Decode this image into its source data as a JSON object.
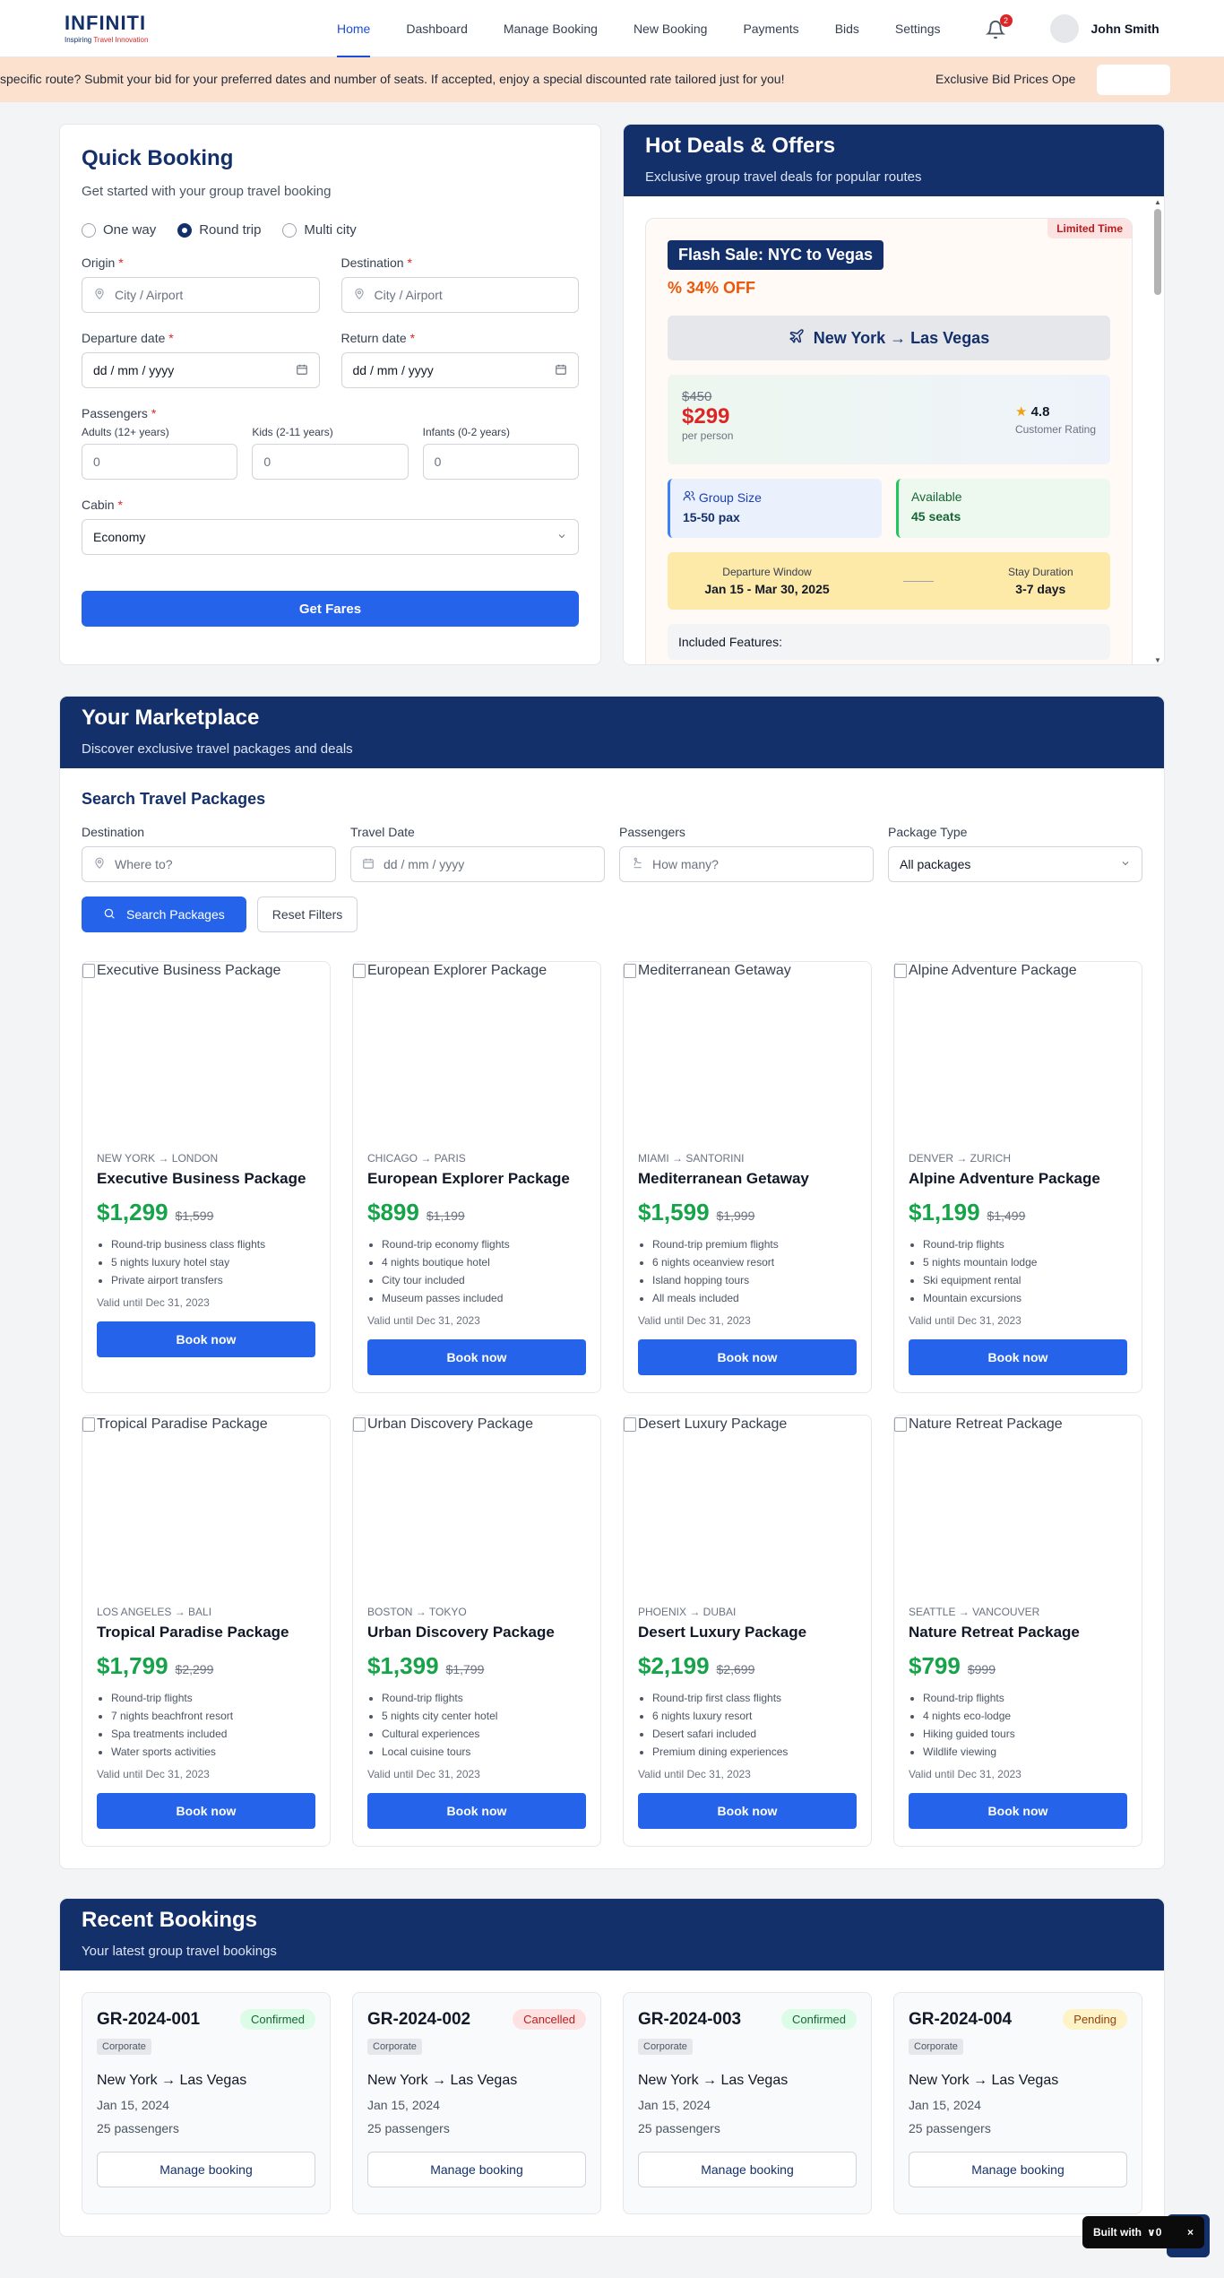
{
  "brand": {
    "name": "INFINITI",
    "tagline_a": "Inspiring ",
    "tagline_b": "Travel Innovation"
  },
  "nav": [
    "Home",
    "Dashboard",
    "Manage Booking",
    "New Booking",
    "Payments",
    "Bids",
    "Settings"
  ],
  "notifications": "2",
  "user": {
    "name": "John Smith"
  },
  "ticker": {
    "text": "specific route? Submit your bid for your preferred dates and number of seats. If accepted, enjoy a special discounted rate tailored just for you!",
    "text2": "Exclusive Bid Prices Ope"
  },
  "quick_booking": {
    "title": "Quick Booking",
    "subtitle": "Get started with your group travel booking",
    "trip_types": [
      "One way",
      "Round trip",
      "Multi city"
    ],
    "origin_label": "Origin",
    "origin_placeholder": "City / Airport",
    "destination_label": "Destination",
    "destination_placeholder": "City / Airport",
    "departure_label": "Departure date",
    "departure_placeholder": "dd / mm / yyyy",
    "return_label": "Return date",
    "return_placeholder": "dd / mm / yyyy",
    "passengers_label": "Passengers",
    "adults_label": "Adults (12+ years)",
    "kids_label": "Kids (2-11 years)",
    "infants_label": "Infants (0-2 years)",
    "adults": "0",
    "kids": "0",
    "infants": "0",
    "cabin_label": "Cabin",
    "cabin_value": "Economy",
    "submit": "Get Fares"
  },
  "hot_deals": {
    "title": "Hot Deals & Offers",
    "subtitle": "Exclusive group travel deals for popular routes",
    "limited": "Limited Time",
    "flash": "Flash Sale: NYC to Vegas",
    "off": "34% OFF",
    "route": "New York → Las Vegas",
    "old_price": "$450",
    "new_price": "$299",
    "per_person": "per person",
    "rating": "4.8",
    "rating_label": "Customer Rating",
    "group_size_label": "Group Size",
    "group_size": "15-50 pax",
    "available_label": "Available",
    "available": "45 seats",
    "window_label": "Departure Window",
    "window": "Jan 15 - Mar 30, 2025",
    "stay_label": "Stay Duration",
    "stay": "3-7 days",
    "features_label": "Included Features:"
  },
  "marketplace": {
    "title": "Your Marketplace",
    "subtitle": "Discover exclusive travel packages and deals",
    "search_title": "Search Travel Packages",
    "destination_label": "Destination",
    "destination_placeholder": "Where to?",
    "date_label": "Travel Date",
    "date_placeholder": "dd / mm / yyyy",
    "passengers_label": "Passengers",
    "passengers_placeholder": "How many?",
    "type_label": "Package Type",
    "type_value": "All packages",
    "search_btn": "Search Packages",
    "reset_btn": "Reset Filters",
    "book_label": "Book now",
    "packages": [
      {
        "alt": "Executive Business Package",
        "route": "NEW YORK → LONDON",
        "name": "Executive Business Package",
        "price": "$1,299",
        "old": "$1,599",
        "features": [
          "Round-trip business class flights",
          "5 nights luxury hotel stay",
          "Private airport transfers"
        ],
        "valid": "Valid until Dec 31, 2023"
      },
      {
        "alt": "European Explorer Package",
        "route": "CHICAGO → PARIS",
        "name": "European Explorer Package",
        "price": "$899",
        "old": "$1,199",
        "features": [
          "Round-trip economy flights",
          "4 nights boutique hotel",
          "City tour included",
          "Museum passes included"
        ],
        "valid": "Valid until Dec 31, 2023"
      },
      {
        "alt": "Mediterranean Getaway",
        "route": "MIAMI → SANTORINI",
        "name": "Mediterranean Getaway",
        "price": "$1,599",
        "old": "$1,999",
        "features": [
          "Round-trip premium flights",
          "6 nights oceanview resort",
          "Island hopping tours",
          "All meals included"
        ],
        "valid": "Valid until Dec 31, 2023"
      },
      {
        "alt": "Alpine Adventure Package",
        "route": "DENVER → ZURICH",
        "name": "Alpine Adventure Package",
        "price": "$1,199",
        "old": "$1,499",
        "features": [
          "Round-trip flights",
          "5 nights mountain lodge",
          "Ski equipment rental",
          "Mountain excursions"
        ],
        "valid": "Valid until Dec 31, 2023"
      },
      {
        "alt": "Tropical Paradise Package",
        "route": "LOS ANGELES → BALI",
        "name": "Tropical Paradise Package",
        "price": "$1,799",
        "old": "$2,299",
        "features": [
          "Round-trip flights",
          "7 nights beachfront resort",
          "Spa treatments included",
          "Water sports activities"
        ],
        "valid": "Valid until Dec 31, 2023"
      },
      {
        "alt": "Urban Discovery Package",
        "route": "BOSTON → TOKYO",
        "name": "Urban Discovery Package",
        "price": "$1,399",
        "old": "$1,799",
        "features": [
          "Round-trip flights",
          "5 nights city center hotel",
          "Cultural experiences",
          "Local cuisine tours"
        ],
        "valid": "Valid until Dec 31, 2023"
      },
      {
        "alt": "Desert Luxury Package",
        "route": "PHOENIX → DUBAI",
        "name": "Desert Luxury Package",
        "price": "$2,199",
        "old": "$2,699",
        "features": [
          "Round-trip first class flights",
          "6 nights luxury resort",
          "Desert safari included",
          "Premium dining experiences"
        ],
        "valid": "Valid until Dec 31, 2023"
      },
      {
        "alt": "Nature Retreat Package",
        "route": "SEATTLE → VANCOUVER",
        "name": "Nature Retreat Package",
        "price": "$799",
        "old": "$999",
        "features": [
          "Round-trip flights",
          "4 nights eco-lodge",
          "Hiking guided tours",
          "Wildlife viewing"
        ],
        "valid": "Valid until Dec 31, 2023"
      }
    ]
  },
  "recent": {
    "title": "Recent Bookings",
    "subtitle": "Your latest group travel bookings",
    "manage_label": "Manage booking",
    "bookings": [
      {
        "id": "GR-2024-001",
        "status": "Confirmed",
        "kind": "confirmed",
        "tag": "Corporate",
        "route": "New York → Las Vegas",
        "date": "Jan 15, 2024",
        "pax": "25 passengers"
      },
      {
        "id": "GR-2024-002",
        "status": "Cancelled",
        "kind": "cancelled",
        "tag": "Corporate",
        "route": "New York → Las Vegas",
        "date": "Jan 15, 2024",
        "pax": "25 passengers"
      },
      {
        "id": "GR-2024-003",
        "status": "Confirmed",
        "kind": "confirmed",
        "tag": "Corporate",
        "route": "New York → Las Vegas",
        "date": "Jan 15, 2024",
        "pax": "25 passengers"
      },
      {
        "id": "GR-2024-004",
        "status": "Pending",
        "kind": "pending",
        "tag": "Corporate",
        "route": "New York → Las Vegas",
        "date": "Jan 15, 2024",
        "pax": "25 passengers"
      }
    ]
  },
  "built_with": {
    "text": "Built with",
    "close": "×"
  },
  "colors": {
    "primary": "#2563eb",
    "navy": "#14306b",
    "price_green": "#16a34a",
    "sale_red": "#dc2626",
    "ticker_bg": "#fde1cf"
  },
  "icons": [
    "map-pin-icon",
    "calendar-icon",
    "chevron-down-icon",
    "plane-icon",
    "star-icon",
    "users-icon",
    "bell-icon",
    "search-icon",
    "percent-icon",
    "passenger-icon",
    "broken-image-icon"
  ]
}
